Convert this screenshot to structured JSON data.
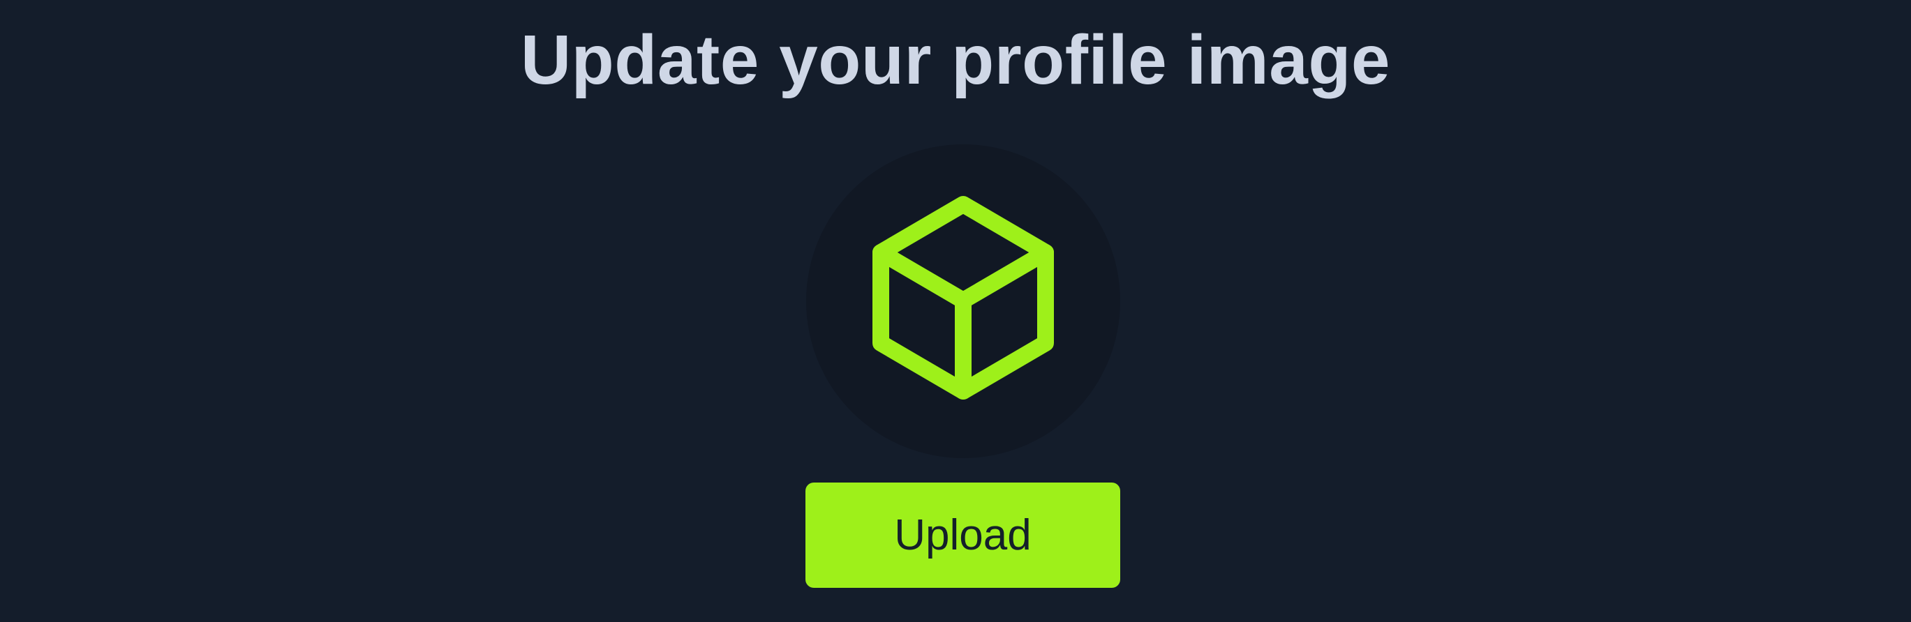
{
  "page": {
    "title": "Update your profile image"
  },
  "avatar": {
    "icon": "cube-icon",
    "icon_color": "#9ef01a",
    "background_color": "#111824"
  },
  "actions": {
    "upload_label": "Upload",
    "upload_color": "#9ef01a"
  },
  "theme": {
    "background": "#141d2b",
    "title_color": "#cfd7e6"
  }
}
